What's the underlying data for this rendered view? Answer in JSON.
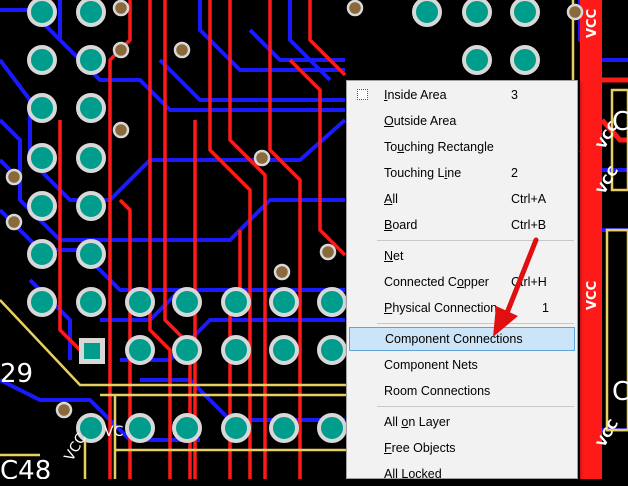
{
  "board": {
    "labels": {
      "u29": "29",
      "c48": "C48",
      "vcc": "VCC",
      "vcc_short": "VC",
      "c_right_1": "C",
      "c_right_2": "C"
    }
  },
  "context_menu": {
    "items": [
      {
        "label": "Inside Area",
        "shortcut": "3",
        "icon": "checkbox-icon"
      },
      {
        "label": "Outside Area",
        "shortcut": ""
      },
      {
        "label": "Touching Rectangle",
        "shortcut": ""
      },
      {
        "label": "Touching Line",
        "shortcut": "2"
      },
      {
        "label": "All",
        "shortcut": "Ctrl+A"
      },
      {
        "label": "Board",
        "shortcut": "Ctrl+B"
      },
      {
        "label": "Net",
        "shortcut": ""
      },
      {
        "label": "Connected Copper",
        "shortcut": "Ctrl+H"
      },
      {
        "label": "Physical Connection",
        "shortcut": "1"
      },
      {
        "label": "Component Connections",
        "shortcut": "",
        "highlighted": true
      },
      {
        "label": "Component Nets",
        "shortcut": ""
      },
      {
        "label": "Room Connections",
        "shortcut": ""
      },
      {
        "label": "All on Layer",
        "shortcut": ""
      },
      {
        "label": "Free Objects",
        "shortcut": ""
      },
      {
        "label": "All Locked",
        "shortcut": ""
      }
    ]
  },
  "colors": {
    "top_layer": "#ff1a1a",
    "bottom_layer": "#1a1aff",
    "pad": "#009c8c",
    "silkscreen": "#e8d060",
    "arrow": "#e01010",
    "menu_highlight": "#cce4f7"
  }
}
